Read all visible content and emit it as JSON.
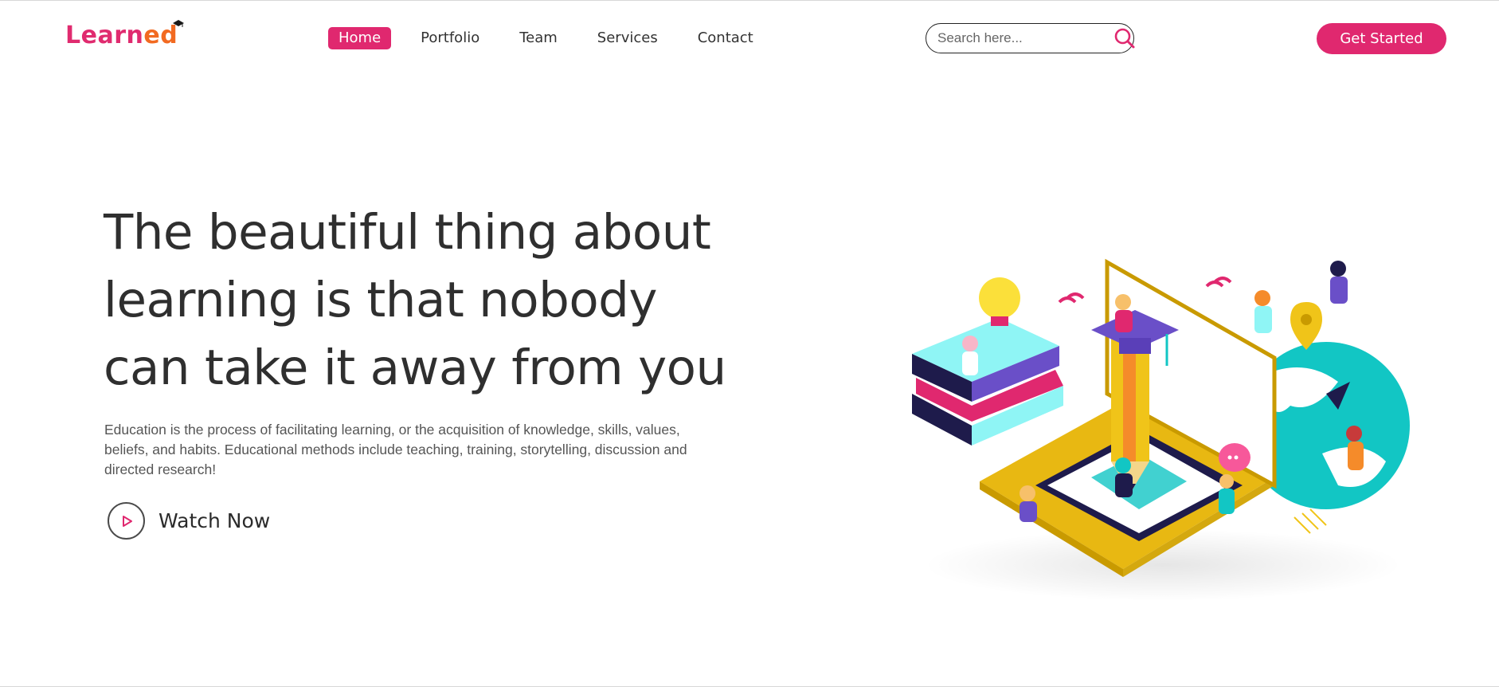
{
  "brand": {
    "logo_part1": "Learn",
    "logo_part2": "ed"
  },
  "nav": {
    "items": [
      {
        "label": "Home",
        "active": true
      },
      {
        "label": "Portfolio",
        "active": false
      },
      {
        "label": "Team",
        "active": false
      },
      {
        "label": "Services",
        "active": false
      },
      {
        "label": "Contact",
        "active": false
      }
    ]
  },
  "search": {
    "placeholder": "Search here...",
    "icon": "search-icon"
  },
  "header": {
    "cta_label": "Get Started"
  },
  "hero": {
    "title_line1": "The beautiful thing about",
    "title_line2": "learning is that nobody",
    "title_line3": "can take it away from you",
    "description": "Education is the process of facilitating learning, or the acquisition of knowledge, skills, values, beliefs, and habits. Educational methods include teaching, training, storytelling, discussion and directed research!",
    "watch_label": "Watch Now"
  },
  "colors": {
    "accent": "#e0286f",
    "text": "#2f2f2f",
    "muted": "#555555"
  }
}
